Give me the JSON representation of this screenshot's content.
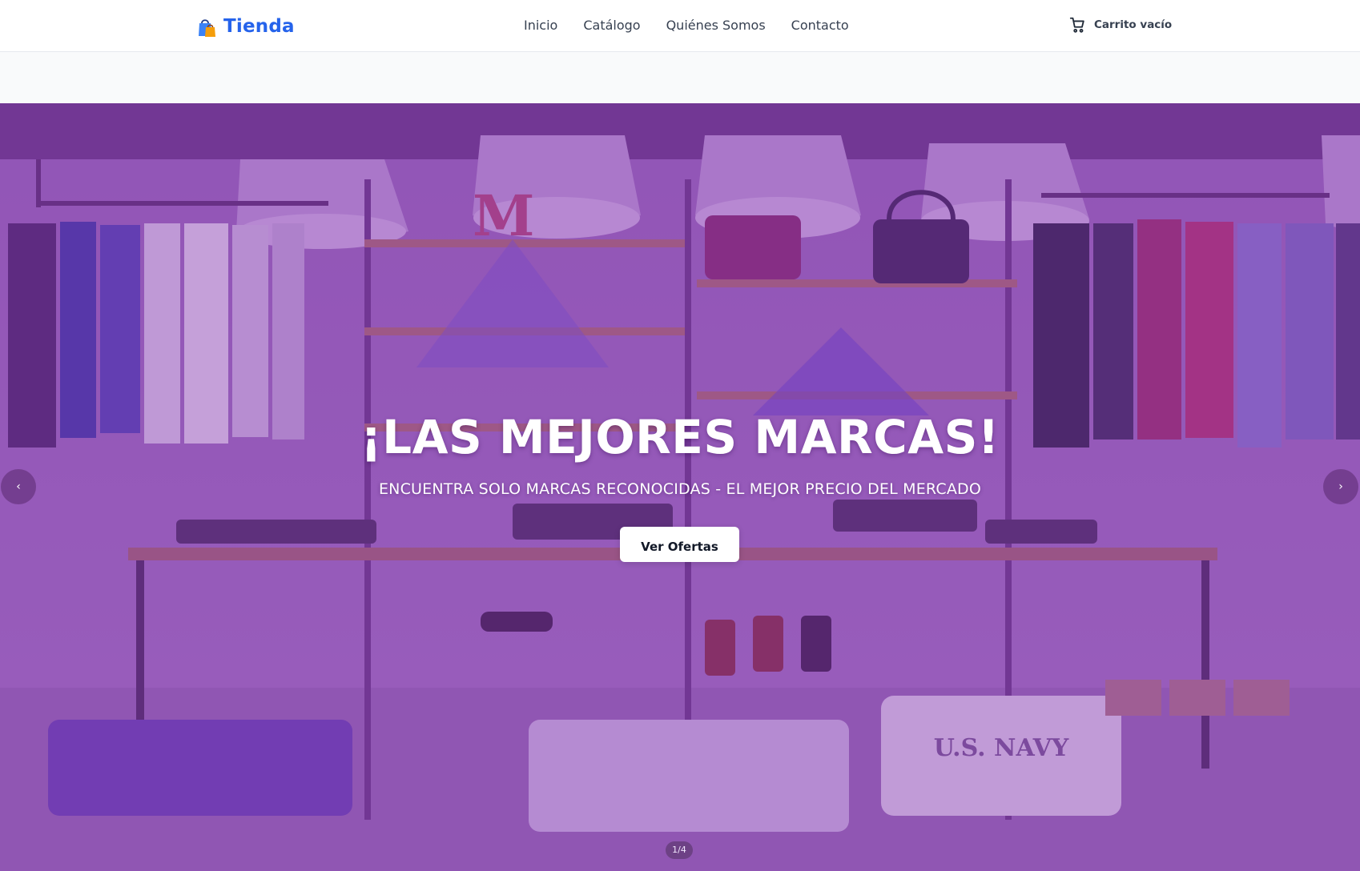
{
  "header": {
    "logo_text": "Tienda",
    "logo_icon": "shopping-bags-icon",
    "nav": [
      {
        "label": "Inicio"
      },
      {
        "label": "Catálogo"
      },
      {
        "label": "Quiénes Somos"
      },
      {
        "label": "Contacto"
      }
    ],
    "cart": {
      "icon": "shopping-cart-icon",
      "label": "Carrito vacío"
    }
  },
  "hero": {
    "title": "¡LAS MEJORES MARCAS!",
    "subtitle": "ENCUENTRA SOLO MARCAS RECONOCIDAS - EL MEJOR PRECIO DEL MERCADO",
    "cta_label": "Ver Ofertas",
    "prev_label": "‹",
    "next_label": "›",
    "slide_indicator": "1/4",
    "background_graphic_text": "U.S. NAVY"
  },
  "colors": {
    "brand": "#2563eb",
    "nav_text": "#374151",
    "overlay": "#8032aa",
    "hero_text": "#ffffff",
    "cta_bg": "#ffffff"
  }
}
